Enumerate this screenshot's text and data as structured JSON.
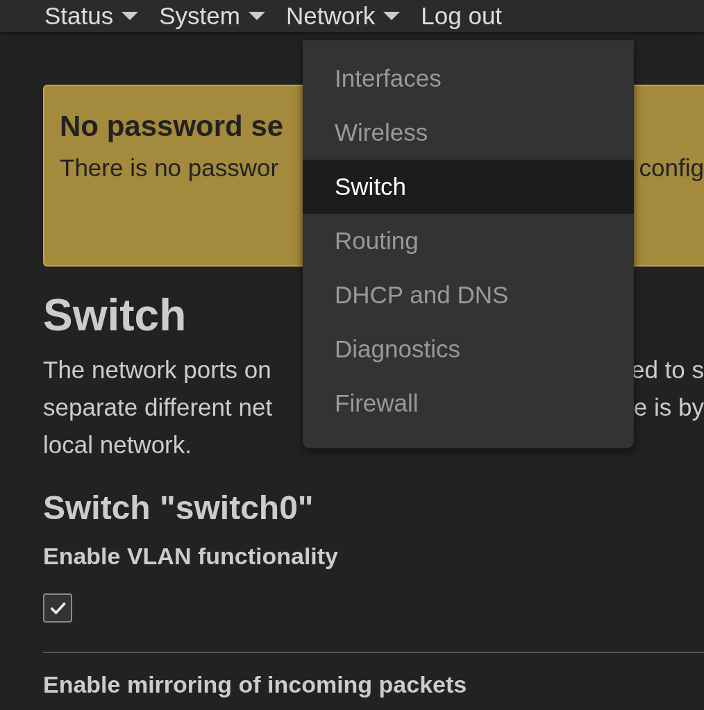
{
  "nav": [
    {
      "label": "Status",
      "dropdown": true
    },
    {
      "label": "System",
      "dropdown": true
    },
    {
      "label": "Network",
      "dropdown": true
    },
    {
      "label": "Log out",
      "dropdown": false
    }
  ],
  "menu": [
    {
      "label": "Interfaces",
      "selected": false
    },
    {
      "label": "Wireless",
      "selected": false
    },
    {
      "label": "Switch",
      "selected": true
    },
    {
      "label": "Routing",
      "selected": false
    },
    {
      "label": "DHCP and DNS",
      "selected": false
    },
    {
      "label": "Diagnostics",
      "selected": false
    },
    {
      "label": "Firewall",
      "selected": false
    }
  ],
  "alert": {
    "title": "No password se",
    "lines": [
      {
        "left": "There is no passwor",
        "right": "config"
      }
    ]
  },
  "page": {
    "title": "Switch",
    "paragraph": [
      {
        "left": "The network ports on",
        "right": "ed to s"
      },
      {
        "left": "separate different net",
        "right": "e is by"
      },
      {
        "left": "local network."
      }
    ]
  },
  "section": {
    "title": "Switch \"switch0\"",
    "options": [
      {
        "label": "Enable VLAN functionality",
        "checked": true
      },
      {
        "label": "Enable mirroring of incoming packets"
      }
    ]
  }
}
